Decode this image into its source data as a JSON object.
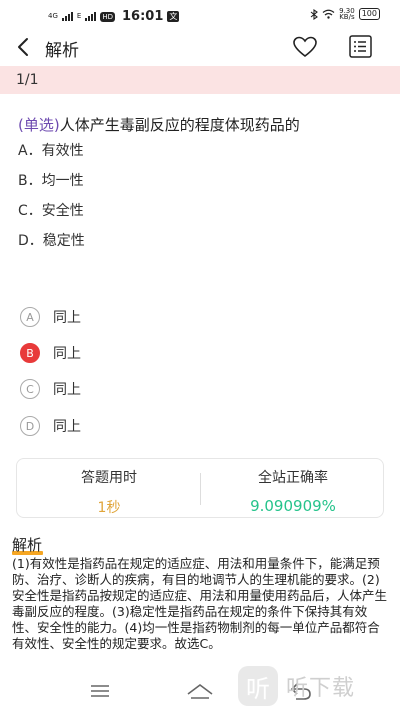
{
  "status_bar": {
    "signal_1": "4G",
    "signal_2": "E",
    "hd": "HD",
    "time": "16:01",
    "app_badge": "文",
    "speed_value": "9.30",
    "speed_unit": "KB/s",
    "battery": "100"
  },
  "nav": {
    "title": "解析"
  },
  "progress": "1/1",
  "question": {
    "type_label": "(单选)",
    "text": "人体产生毒副反应的程度体现药品的",
    "options": [
      "A．有效性",
      "B．均一性",
      "C．安全性",
      "D．稳定性"
    ]
  },
  "choices": [
    {
      "letter": "A",
      "text": "同上"
    },
    {
      "letter": "B",
      "text": "同上"
    },
    {
      "letter": "C",
      "text": "同上"
    },
    {
      "letter": "D",
      "text": "同上"
    }
  ],
  "stats": {
    "time_label": "答题用时",
    "time_value": "1秒",
    "rate_label": "全站正确率",
    "rate_value": "9.090909%"
  },
  "analysis": {
    "heading": "解析",
    "text": "(1)有效性是指药品在规定的适应症、用法和用量条件下，能满足预防、治疗、诊断人的疾病，有目的地调节人的生理机能的要求。(2)安全性是指药品按规定的适应症、用法和用量使用药品后，人体产生毒副反应的程度。(3)稳定性是指药品在规定的条件下保持其有效性、安全性的能力。(4)均一性是指药物制剂的每一单位产品都符合有效性、安全性的规定要求。故选C。"
  },
  "watermark": {
    "logo_char": "听",
    "text": "听下载"
  },
  "colors": {
    "progress_band": "#fbe3e3",
    "question_type": "#6e4bb0",
    "wrong_choice": "#e83a3a",
    "time_value": "#e0a53a",
    "rate_value": "#25c38b",
    "analysis_underline": "#f5a623"
  },
  "icons": {
    "back": "chevron-left-icon",
    "favorite": "heart-icon",
    "answer_card": "list-icon",
    "system_menu": "menu-icon",
    "system_home": "home-icon",
    "system_back": "back-arrow-icon"
  }
}
